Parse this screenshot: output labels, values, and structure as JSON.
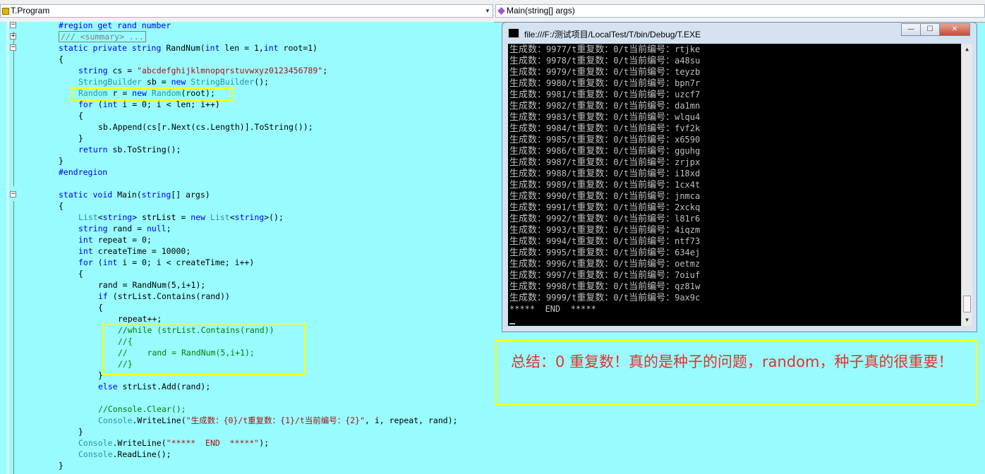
{
  "navbar": {
    "class_combo": "T.Program",
    "member_combo": "Main(string[] args)"
  },
  "code": {
    "region_start": "#region get rand number",
    "summary_collapsed": "/// <summary> ...",
    "l_sig": [
      "static private string ",
      "RandNum(",
      "int",
      " len = 1,",
      "int",
      " root=1)"
    ],
    "l_open1": "{",
    "l_cs": [
      "string",
      " cs = ",
      "\"abcdefghijklmnopqrstuvwxyz0123456789\"",
      ";"
    ],
    "l_sb": [
      "StringBuilder",
      " sb = ",
      "new",
      " ",
      "StringBuilder",
      "();"
    ],
    "l_random": [
      "Random",
      " r = ",
      "new",
      " ",
      "Random",
      "(root);"
    ],
    "l_for1": [
      "for",
      " (",
      "int",
      " i = 0; i < len; i++)"
    ],
    "l_open2": "{",
    "l_append": "sb.Append(cs[r.Next(cs.Length)].ToString());",
    "l_close2": "}",
    "l_return": [
      "return",
      " sb.ToString();"
    ],
    "l_close1": "}",
    "region_end": "#endregion",
    "l_main": [
      "static",
      " ",
      "void",
      " Main(",
      "string",
      "[] args)"
    ],
    "l_open3": "{",
    "l_list": [
      "List",
      "<",
      "string",
      "> strList = ",
      "new",
      " ",
      "List",
      "<",
      "string",
      ">();"
    ],
    "l_rand": [
      "string",
      " rand = ",
      "null",
      ";"
    ],
    "l_repeat": [
      "int",
      " repeat = 0;"
    ],
    "l_ctime": [
      "int",
      " createTime = 10000;"
    ],
    "l_for2": [
      "for",
      " (",
      "int",
      " i = 0; i < createTime; i++)"
    ],
    "l_open4": "{",
    "l_randnum": "rand = RandNum(5,i+1);",
    "l_if": [
      "if",
      " (strList.Contains(rand))"
    ],
    "l_open5": "{",
    "l_repeatpp": "repeat++;",
    "l_c1": "//while (strList.Contains(rand))",
    "l_c2": "//{",
    "l_c3": "//    rand = RandNum(5,i+1);",
    "l_c4": "//}",
    "l_close5": "}",
    "l_else": [
      "else",
      " strList.Add(rand);"
    ],
    "l_clear": "//Console.Clear();",
    "l_wl": [
      "Console",
      ".WriteLine(",
      "\"生成数：{0}/t重复数：{1}/t当前编号：{2}\"",
      ", i, repeat, rand);"
    ],
    "l_close4": "}",
    "l_wl2": [
      "Console",
      ".WriteLine(",
      "\"*****  END  *****\"",
      ");"
    ],
    "l_readline": [
      "Console",
      ".ReadLine();"
    ],
    "l_close3": "}"
  },
  "console": {
    "title": "file:///F:/测试项目/LocalTest/T/bin/Debug/T.EXE",
    "label_gen": "生成数：",
    "label_rep": "重复数：",
    "label_cur": "当前编号：",
    "sep": "/t",
    "rows": [
      {
        "n": "9977",
        "r": "0",
        "c": "rtjke"
      },
      {
        "n": "9978",
        "r": "0",
        "c": "a48su"
      },
      {
        "n": "9979",
        "r": "0",
        "c": "teyzb"
      },
      {
        "n": "9980",
        "r": "0",
        "c": "bpn7r"
      },
      {
        "n": "9981",
        "r": "0",
        "c": "uzcf7"
      },
      {
        "n": "9982",
        "r": "0",
        "c": "da1mn"
      },
      {
        "n": "9983",
        "r": "0",
        "c": "wlqu4"
      },
      {
        "n": "9984",
        "r": "0",
        "c": "fvf2k"
      },
      {
        "n": "9985",
        "r": "0",
        "c": "x6590"
      },
      {
        "n": "9986",
        "r": "0",
        "c": "gguhg"
      },
      {
        "n": "9987",
        "r": "0",
        "c": "zrjpx"
      },
      {
        "n": "9988",
        "r": "0",
        "c": "i18xd"
      },
      {
        "n": "9989",
        "r": "0",
        "c": "1cx4t"
      },
      {
        "n": "9990",
        "r": "0",
        "c": "jnmca"
      },
      {
        "n": "9991",
        "r": "0",
        "c": "2xckq"
      },
      {
        "n": "9992",
        "r": "0",
        "c": "l81r6"
      },
      {
        "n": "9993",
        "r": "0",
        "c": "4iqzm"
      },
      {
        "n": "9994",
        "r": "0",
        "c": "ntf73"
      },
      {
        "n": "9995",
        "r": "0",
        "c": "634ej"
      },
      {
        "n": "9996",
        "r": "0",
        "c": "oetmz"
      },
      {
        "n": "9997",
        "r": "0",
        "c": "7oiuf"
      },
      {
        "n": "9998",
        "r": "0",
        "c": "qz81w"
      },
      {
        "n": "9999",
        "r": "0",
        "c": "9ax9c"
      }
    ],
    "end_line": "*****  END  *****"
  },
  "note": {
    "text": "总结：0 重复数！真的是种子的问题，random，种子真的很重要！"
  },
  "colors": {
    "editor_bg": "#98fbfd",
    "keyword": "#0000ff",
    "type": "#2b91af",
    "string": "#a31515",
    "comment": "#008000",
    "highlight_box": "#ffff00",
    "note_text": "#e8302a"
  }
}
